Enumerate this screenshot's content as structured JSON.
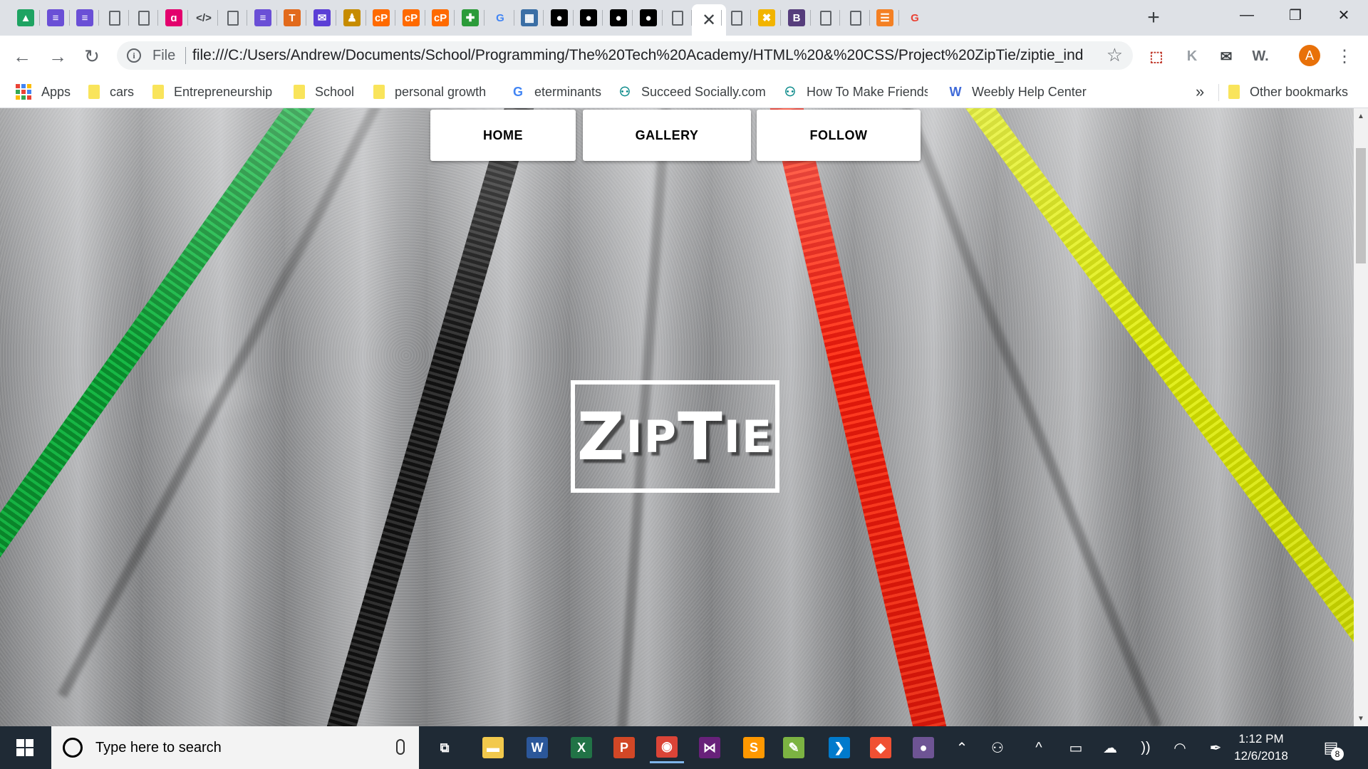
{
  "browser": {
    "tab_count": 30,
    "active_tab_close": "✕",
    "new_tab": "+",
    "window_controls": {
      "minimize": "—",
      "restore": "❐",
      "close": "✕"
    },
    "favicons": [
      {
        "icon": "drive-icon",
        "glyph": "▲",
        "color": "#1ea362"
      },
      {
        "icon": "docs-icon",
        "glyph": "≡",
        "color": "#6a4fd6"
      },
      {
        "icon": "docs-icon",
        "glyph": "≡",
        "color": "#6a4fd6"
      },
      {
        "icon": "page-icon",
        "glyph": "",
        "color": ""
      },
      {
        "icon": "page-icon",
        "glyph": "",
        "color": ""
      },
      {
        "icon": "swirl-icon",
        "glyph": "ɑ",
        "color": "#e3006d"
      },
      {
        "icon": "code-icon",
        "glyph": "</>",
        "color": "#3c4043"
      },
      {
        "icon": "page-icon",
        "glyph": "",
        "color": ""
      },
      {
        "icon": "docs-icon",
        "glyph": "≡",
        "color": "#6a4fd6"
      },
      {
        "icon": "t-icon",
        "glyph": "T",
        "color": "#e26a1c"
      },
      {
        "icon": "mail-icon",
        "glyph": "✉",
        "color": "#5b3fd6"
      },
      {
        "icon": "people-icon",
        "glyph": "♟",
        "color": "#c68b00"
      },
      {
        "icon": "cp-icon",
        "glyph": "cP",
        "color": "#ff6a00"
      },
      {
        "icon": "cp-icon",
        "glyph": "cP",
        "color": "#ff6a00"
      },
      {
        "icon": "cp-icon",
        "glyph": "cP",
        "color": "#ff6a00"
      },
      {
        "icon": "puzzle-icon",
        "glyph": "✚",
        "color": "#2b9b3a"
      },
      {
        "icon": "google-icon",
        "glyph": "G",
        "color": "#4285f4"
      },
      {
        "icon": "grid-app-icon",
        "glyph": "▦",
        "color": "#3a6ea5"
      },
      {
        "icon": "github-icon",
        "glyph": "●",
        "color": "#000000"
      },
      {
        "icon": "github-icon",
        "glyph": "●",
        "color": "#000000"
      },
      {
        "icon": "github-icon",
        "glyph": "●",
        "color": "#000000"
      },
      {
        "icon": "github-icon",
        "glyph": "●",
        "color": "#000000"
      },
      {
        "icon": "page-icon",
        "glyph": "",
        "color": ""
      },
      {
        "icon": "active-tab",
        "glyph": "",
        "color": ""
      },
      {
        "icon": "page-icon",
        "glyph": "",
        "color": ""
      },
      {
        "icon": "x-icon",
        "glyph": "✖",
        "color": "#f2b400"
      },
      {
        "icon": "bootstrap-icon",
        "glyph": "B",
        "color": "#563d7c"
      },
      {
        "icon": "page-icon",
        "glyph": "",
        "color": ""
      },
      {
        "icon": "page-icon",
        "glyph": "",
        "color": ""
      },
      {
        "icon": "stack-icon",
        "glyph": "☰",
        "color": "#f48024"
      },
      {
        "icon": "google-icon",
        "glyph": "G",
        "color": "#ea4335"
      }
    ]
  },
  "toolbar": {
    "back": "←",
    "forward": "→",
    "reload": "↻",
    "scheme_label": "File",
    "url": "file:///C:/Users/Andrew/Documents/School/Programming/The%20Tech%20Academy/HTML%20&%20CSS/Project%20ZipTie/ziptie_ind...",
    "star": "☆",
    "extensions": [
      {
        "icon": "acrobat-icon",
        "glyph": "⬚",
        "color": "#c0392b"
      },
      {
        "icon": "k-icon",
        "glyph": "K",
        "color": "#9aa0a6"
      },
      {
        "icon": "mail-ext-icon",
        "glyph": "✉",
        "color": "#3c4043"
      },
      {
        "icon": "weebly-ext-icon",
        "glyph": "W.",
        "color": "#5f6368"
      }
    ],
    "avatar_letter": "A",
    "menu": "⋮"
  },
  "bookmarks": {
    "apps": "Apps",
    "items": [
      {
        "label": "cars",
        "type": "folder"
      },
      {
        "label": "Entrepreneurship",
        "type": "folder"
      },
      {
        "label": "School",
        "type": "folder"
      },
      {
        "label": "personal growth",
        "type": "folder"
      },
      {
        "label": "eterminants",
        "type": "google"
      },
      {
        "label": "Succeed Socially.com",
        "type": "site"
      },
      {
        "label": "How To Make Friends",
        "type": "site"
      },
      {
        "label": "Weebly Help Center",
        "type": "weebly"
      }
    ],
    "more": "»",
    "other": "Other bookmarks"
  },
  "page": {
    "nav": [
      "HOME",
      "GALLERY",
      "FOLLOW"
    ],
    "logo": {
      "z": "Z",
      "ip": "IP",
      "t": "T",
      "ie": "IE"
    },
    "zipper_colors": {
      "green": "#17b845",
      "black": "#111111",
      "red": "#ff2a10",
      "yellow": "#dbe800"
    }
  },
  "taskbar": {
    "search_placeholder": "Type here to search",
    "time": "1:12 PM",
    "date": "12/6/2018",
    "notification_count": "8",
    "apps": [
      {
        "icon": "task-view-icon",
        "glyph": "⧉",
        "color": "transparent"
      },
      {
        "icon": "file-explorer-icon",
        "glyph": "▬",
        "color": "#f2c94c"
      },
      {
        "icon": "word-icon",
        "glyph": "W",
        "color": "#2b579a"
      },
      {
        "icon": "excel-icon",
        "glyph": "X",
        "color": "#217346"
      },
      {
        "icon": "powerpoint-icon",
        "glyph": "P",
        "color": "#d24726"
      },
      {
        "icon": "chrome-icon",
        "glyph": "◉",
        "color": "#db4437"
      },
      {
        "icon": "visual-studio-icon",
        "glyph": "⋈",
        "color": "#68217a"
      },
      {
        "icon": "sublime-icon",
        "glyph": "S",
        "color": "#ff9800"
      },
      {
        "icon": "notepadpp-icon",
        "glyph": "✎",
        "color": "#7cb342"
      },
      {
        "icon": "vscode-icon",
        "glyph": "❯",
        "color": "#007acc"
      },
      {
        "icon": "git-icon",
        "glyph": "◆",
        "color": "#f05033"
      },
      {
        "icon": "github-desktop-icon",
        "glyph": "●",
        "color": "#6e5494"
      }
    ],
    "tray": [
      {
        "icon": "chevron-up-icon",
        "glyph": "⌃"
      },
      {
        "icon": "people-icon",
        "glyph": "⚇"
      },
      {
        "icon": "show-hidden-icon",
        "glyph": "^"
      },
      {
        "icon": "battery-icon",
        "glyph": "▭"
      },
      {
        "icon": "onedrive-icon",
        "glyph": "☁"
      },
      {
        "icon": "audio-icon",
        "glyph": "))"
      },
      {
        "icon": "wifi-icon",
        "glyph": "◠"
      },
      {
        "icon": "pen-icon",
        "glyph": "✒"
      }
    ]
  }
}
